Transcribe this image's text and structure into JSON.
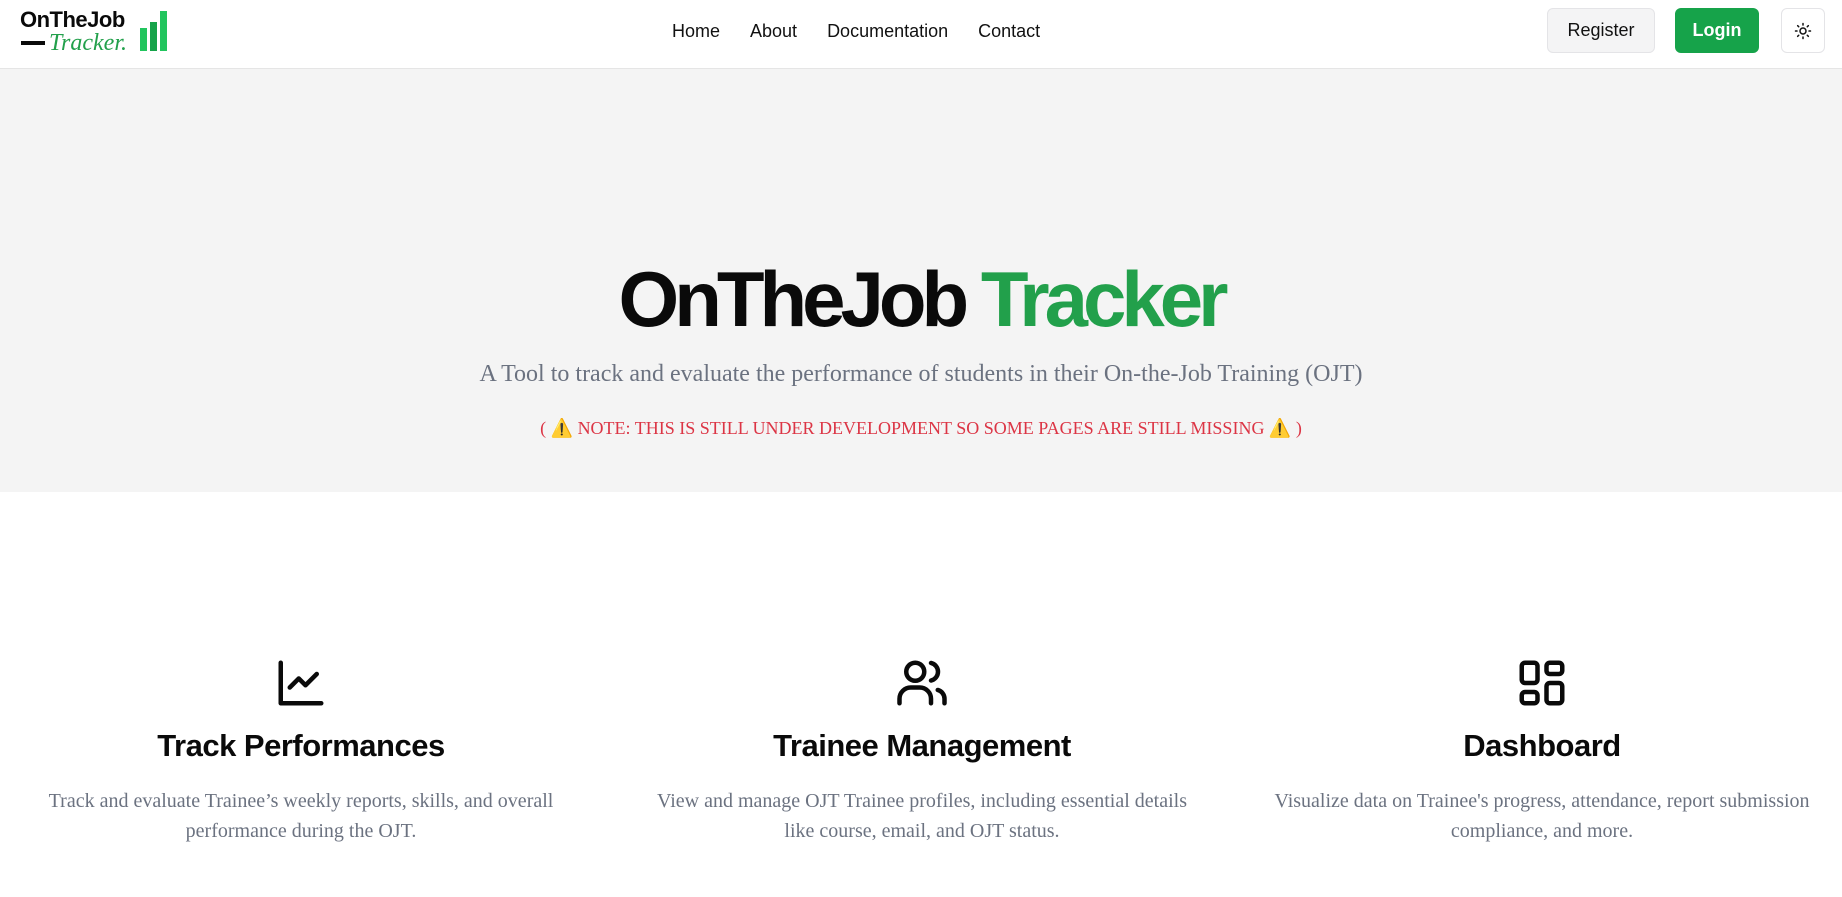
{
  "header": {
    "logo": {
      "top": "OnTheJob",
      "bottom": "Tracker.",
      "bars_color": "#22c55e"
    },
    "nav": [
      {
        "label": "Home"
      },
      {
        "label": "About"
      },
      {
        "label": "Documentation"
      },
      {
        "label": "Contact"
      }
    ],
    "register_label": "Register",
    "login_label": "Login",
    "theme_icon": "sun-icon"
  },
  "hero": {
    "title_part1": "OnTheJob",
    "title_part2": "Tracker",
    "subtitle": "A Tool to track and evaluate the performance of students in their On-the-Job Training (OJT)",
    "note": "( ⚠️ NOTE: THIS IS STILL UNDER DEVELOPMENT SO SOME PAGES ARE STILL MISSING ⚠️ )"
  },
  "features": [
    {
      "icon": "line-chart-icon",
      "title": "Track Performances",
      "description": "Track and evaluate Trainee’s weekly reports, skills, and overall performance during the OJT."
    },
    {
      "icon": "users-icon",
      "title": "Trainee Management",
      "description": "View and manage OJT Trainee profiles, including essential details like course, email, and OJT status."
    },
    {
      "icon": "dashboard-icon",
      "title": "Dashboard",
      "description": "Visualize data on Trainee's progress, attendance, report submission compliance, and more."
    }
  ],
  "colors": {
    "brand_green": "#16a34a",
    "title_green": "#22a04b",
    "note_red": "#dc3545",
    "hero_bg": "#f4f4f4",
    "muted_text": "#6b7280"
  }
}
